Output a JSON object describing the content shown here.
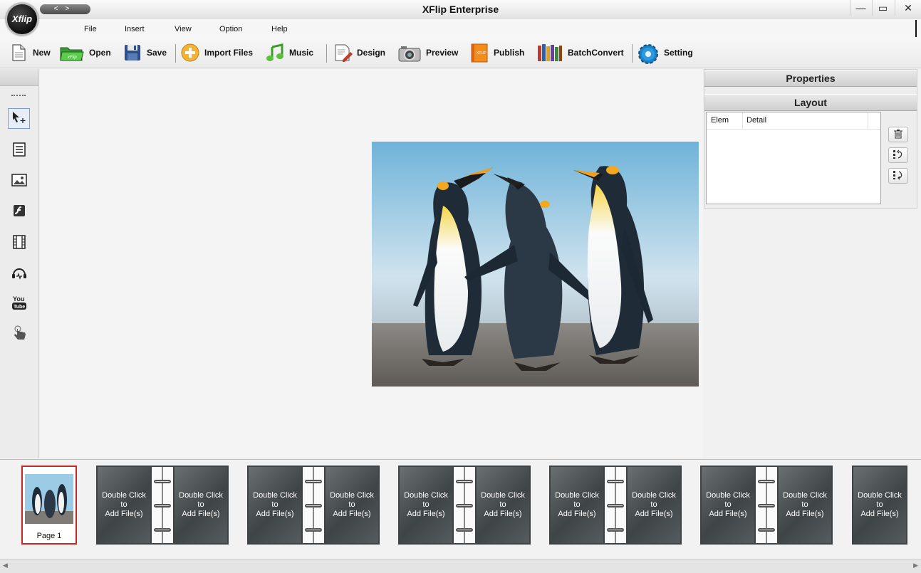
{
  "window": {
    "title": "XFlip Enterprise",
    "logo_text": "Xflip",
    "nav_back": "<",
    "nav_forward": ">",
    "minimize": "—",
    "maximize": "▭",
    "close": "✕"
  },
  "menu": [
    "File",
    "Insert",
    "View",
    "Option",
    "Help"
  ],
  "toolbar": [
    {
      "label": "New",
      "icon": "new-document-icon"
    },
    {
      "label": "Open",
      "icon": "open-folder-icon"
    },
    {
      "label": "Save",
      "icon": "save-disk-icon"
    },
    {
      "label": "Import Files",
      "icon": "import-plus-icon"
    },
    {
      "label": "Music",
      "icon": "music-note-icon"
    },
    {
      "label": "Design",
      "icon": "design-icon"
    },
    {
      "label": "Preview",
      "icon": "camera-icon"
    },
    {
      "label": "Publish",
      "icon": "publish-book-icon",
      "badge": "XFLIP"
    },
    {
      "label": "BatchConvert",
      "icon": "books-icon"
    },
    {
      "label": "Setting",
      "icon": "gear-icon"
    }
  ],
  "tools": [
    "select-move-icon",
    "text-icon",
    "image-icon",
    "flash-icon",
    "video-icon",
    "audio-icon",
    "youtube-icon",
    "hand-pointer-icon"
  ],
  "tool_glyphs": {
    "youtube": "You\nTube"
  },
  "panel": {
    "properties_title": "Properties",
    "layout_title": "Layout",
    "columns": [
      "Elem",
      "Detail"
    ]
  },
  "canvas": {
    "image": "king-penguins-photo"
  },
  "pages": {
    "page1_caption": "Page 1",
    "placeholder_line1": "Double Click",
    "placeholder_line2": "to",
    "placeholder_line3": "Add File(s)"
  },
  "colors": {
    "selected_page_border": "#c62828",
    "placeholder_page": "#4f5557",
    "active_tool_border": "#7a9ad8"
  }
}
